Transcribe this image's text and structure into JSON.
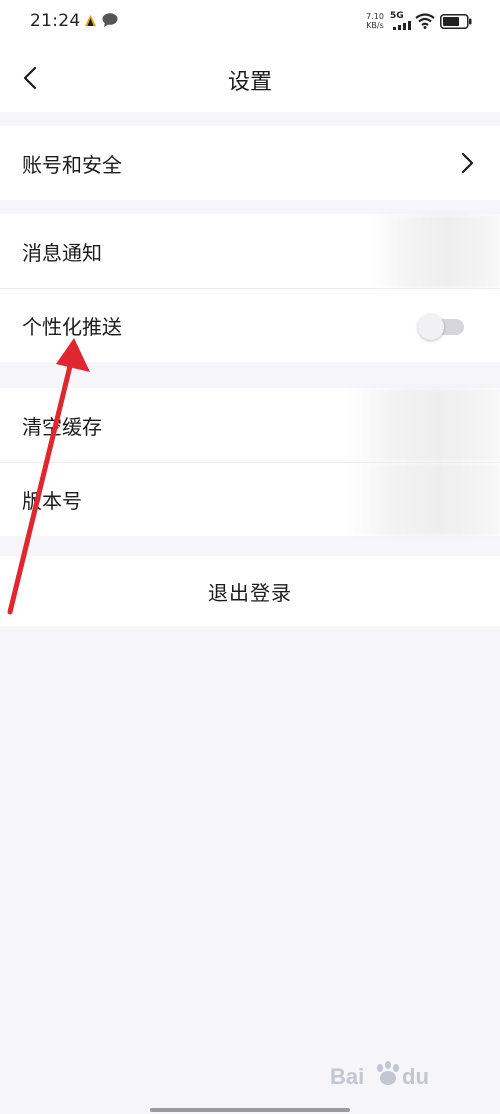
{
  "status_bar": {
    "time": "21:24",
    "net_speed_value": "7.10",
    "net_speed_unit": "KB/s",
    "network_type": "5G",
    "icons": [
      "app-notification-icon",
      "chat-bubble-icon",
      "signal-icon",
      "wifi-icon",
      "battery-icon"
    ]
  },
  "header": {
    "back_icon": "chevron-left-icon",
    "title": "设置"
  },
  "groups": {
    "account": {
      "label": "账号和安全",
      "icon": "chevron-right-icon"
    },
    "notify": {
      "items": [
        {
          "label": "消息通知"
        },
        {
          "label": "个性化推送",
          "toggle_on": false
        }
      ]
    },
    "misc": {
      "items": [
        {
          "label": "清空缓存"
        },
        {
          "label": "版本号"
        }
      ]
    }
  },
  "logout": {
    "label": "退出登录"
  },
  "watermark": {
    "icon": "baidu-paw-icon"
  },
  "colors": {
    "background": "#f5f5fa",
    "surface": "#ffffff",
    "annotation_arrow": "#e0262e",
    "toggle_off_track": "#d6d6dc"
  }
}
